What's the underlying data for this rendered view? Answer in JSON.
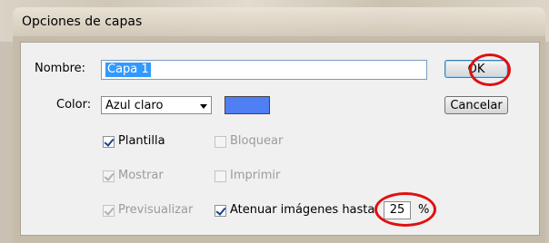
{
  "dialog": {
    "title": "Opciones de capas",
    "name_label": "Nombre:",
    "name_value": "Capa 1",
    "color_label": "Color:",
    "color_value": "Azul claro",
    "color_swatch": "#4f7ef5",
    "ok_label": "OK",
    "cancel_label": "Cancelar",
    "options": {
      "plantilla": {
        "label": "Plantilla",
        "checked": true,
        "enabled": true
      },
      "bloquear": {
        "label": "Bloquear",
        "checked": false,
        "enabled": false
      },
      "mostrar": {
        "label": "Mostrar",
        "checked": true,
        "enabled": false
      },
      "imprimir": {
        "label": "Imprimir",
        "checked": false,
        "enabled": false
      },
      "previsualizar": {
        "label": "Previsualizar",
        "checked": true,
        "enabled": false
      },
      "atenuar": {
        "label": "Atenuar imágenes hasta:",
        "checked": true,
        "enabled": true
      }
    },
    "dim_value": "25",
    "dim_unit": "%"
  }
}
